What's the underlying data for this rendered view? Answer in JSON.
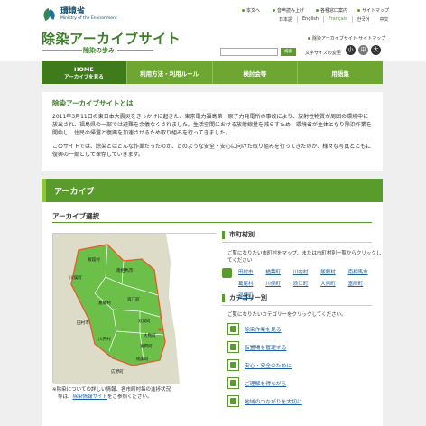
{
  "header": {
    "ministry_name_ja": "環境省",
    "ministry_name_en": "Ministry of the Environment",
    "site_title": "除染アーカイブサイト",
    "site_subtitle": "除染の歩み",
    "util_links": [
      "本文へ",
      "音声読み上げ",
      "各種窓口案内",
      "サイトマップ"
    ],
    "languages": [
      "日本語",
      "English",
      "Français",
      "한국어",
      "中文"
    ],
    "active_language": "Français",
    "sitemap_link": "除染アーカイブサイト サイトマップ",
    "search_button": "検索",
    "text_size_label": "文字サイズの変更",
    "text_sizes": [
      "小",
      "中",
      "大"
    ]
  },
  "nav": {
    "items": [
      {
        "line1": "HOME",
        "line2": "アーカイブを見る"
      },
      {
        "line1": "利用方法・利用ルール",
        "line2": ""
      },
      {
        "line1": "検討会等",
        "line2": ""
      },
      {
        "line1": "用語集",
        "line2": ""
      }
    ]
  },
  "about": {
    "title": "除染アーカイブサイトとは",
    "p1": "2011年3月11日の東日本大震災をきっかけに起きた、東京電力福島第一原子力発電所の事故により、放射性物質が周囲の環境中に放出され、福島県の一部では避難を余儀なくされました。生活空間における放射線量を減らすため、環境省が主体となり除染作業を開始し、住民の帰還と復興を加速させるため取り組みを行ってきました。",
    "p2": "このサイトでは、除染とはどんな作業だったのか、どのような安全・安心に向けた取り組みを行ってきたのか、様々な写真とともに復興の一部として保存していきます。"
  },
  "archive": {
    "heading": "アーカイブ",
    "select_title": "アーカイブ選択",
    "map_labels": [
      "飯舘村",
      "南相馬市",
      "川俣町",
      "葛尾村",
      "浪江町",
      "田村市",
      "双葉町",
      "大熊町",
      "川内村",
      "富岡町",
      "楢葉町",
      "広野町"
    ],
    "map_note_1": "※除染についての詳しい情報、各市町村毎の進捗状況",
    "map_note_2": "等は、",
    "map_note_link": "除染情報サイト",
    "map_note_3": "をご参照ください。",
    "by_town_title": "市町村別",
    "by_town_desc": "ご覧になりたい市町村をマップ、または市町村別一覧からクリックしてください",
    "towns": [
      "田村市",
      "楢葉町",
      "川内村",
      "飯舘村",
      "南相馬市",
      "葛尾村",
      "川俣町",
      "浪江町",
      "大熊町",
      "富岡町",
      "双葉町"
    ],
    "by_category_title": "カテゴリー別",
    "by_category_desc": "ご覧になりたいカテゴリーをクリックしてください。",
    "categories": [
      "除染作業を見る",
      "仮置場を管理する",
      "安心・安全のために",
      "ご理解を得ながら",
      "地域のつながりを大切に"
    ]
  },
  "colors": {
    "brand_green": "#5a9c2c",
    "dark_green": "#3f7b1a",
    "link_blue": "#1a5fa0"
  }
}
